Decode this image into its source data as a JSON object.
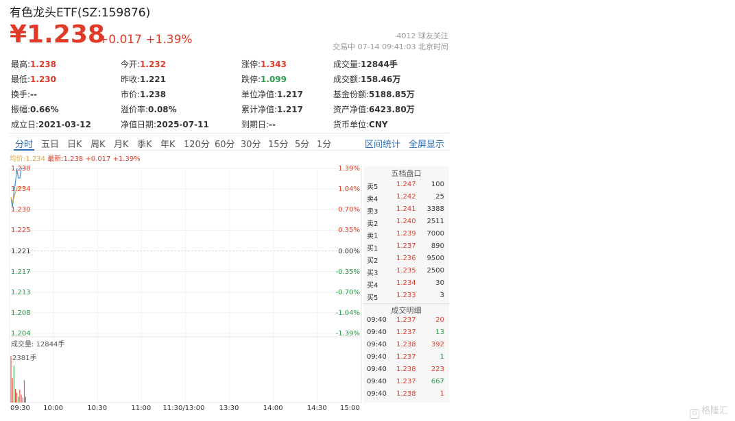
{
  "header": {
    "title": "有色龙头ETF(SZ:159876)",
    "price": "¥1.238",
    "change": "+0.017 +1.39%",
    "followers": "4012 球友关注",
    "status": "交易中 07-14 09:41:03 北京时间"
  },
  "stats": [
    [
      {
        "label": "最高:",
        "value": "1.238",
        "color": "red"
      },
      {
        "label": "今开:",
        "value": "1.232",
        "color": "red"
      },
      {
        "label": "涨停:",
        "value": "1.343",
        "color": "red"
      },
      {
        "label": "成交量:",
        "value": "12844手",
        "color": "dark"
      }
    ],
    [
      {
        "label": "最低:",
        "value": "1.230",
        "color": "red"
      },
      {
        "label": "昨收:",
        "value": "1.221",
        "color": "dark"
      },
      {
        "label": "跌停:",
        "value": "1.099",
        "color": "green"
      },
      {
        "label": "成交额:",
        "value": "158.46万",
        "color": "dark"
      }
    ],
    [
      {
        "label": "换手:",
        "value": "--",
        "color": "dark"
      },
      {
        "label": "市价:",
        "value": "1.238",
        "color": "dark"
      },
      {
        "label": "单位净值:",
        "value": "1.217",
        "color": "dark"
      },
      {
        "label": "基金份额:",
        "value": "5188.85万",
        "color": "dark"
      }
    ],
    [
      {
        "label": "振幅:",
        "value": "0.66%",
        "color": "dark"
      },
      {
        "label": "溢价率:",
        "value": "0.08%",
        "color": "dark"
      },
      {
        "label": "累计净值:",
        "value": "1.217",
        "color": "dark"
      },
      {
        "label": "资产净值:",
        "value": "6423.80万",
        "color": "dark"
      }
    ],
    [
      {
        "label": "成立日:",
        "value": "2021-03-12",
        "color": "dark"
      },
      {
        "label": "净值日期:",
        "value": "2025-07-11",
        "color": "dark"
      },
      {
        "label": "到期日:",
        "value": "--",
        "color": "dark"
      },
      {
        "label": "货币单位:",
        "value": "CNY",
        "color": "dark"
      }
    ]
  ],
  "tabs": [
    "分时",
    "五日",
    "日K",
    "周K",
    "月K",
    "季K",
    "年K",
    "120分",
    "60分",
    "30分",
    "15分",
    "5分",
    "1分"
  ],
  "active_tab": "分时",
  "tab_links": {
    "range_stats": "区间统计",
    "fullscreen": "全屏显示"
  },
  "legend": {
    "avg": "均价:1.234",
    "last": "最新:1.238 +0.017 +1.39%"
  },
  "chart_data": {
    "type": "line",
    "prev_close": 1.221,
    "y_price_ticks": [
      "1.238",
      "1.234",
      "1.230",
      "1.225",
      "1.221",
      "1.217",
      "1.213",
      "1.208",
      "1.204"
    ],
    "y_pct_ticks": [
      "1.39%",
      "1.04%",
      "0.70%",
      "0.35%",
      "0.00%",
      "-0.35%",
      "-0.70%",
      "-1.04%",
      "-1.39%"
    ],
    "ylim": [
      1.204,
      1.238
    ],
    "x_ticks": [
      "09:30",
      "10:00",
      "10:30",
      "11:00",
      "11:30/13:00",
      "13:30",
      "14:00",
      "14:30",
      "15:00"
    ],
    "series": [
      {
        "name": "最新",
        "color": "#3d8fd8",
        "values": [
          1.232,
          1.23,
          1.233,
          1.235,
          1.238,
          1.236,
          1.236,
          1.238,
          1.238,
          1.238,
          1.238
        ]
      },
      {
        "name": "均价",
        "color": "#e8a33a",
        "values": [
          1.232,
          1.231,
          1.232,
          1.233,
          1.234,
          1.234,
          1.234,
          1.234,
          1.234,
          1.234,
          1.234
        ]
      }
    ],
    "volume_label": "成交量: 12844手",
    "volume_max": "2381手",
    "volume_bars": [
      {
        "v": 2381,
        "c": "red"
      },
      {
        "v": 1250,
        "c": "red"
      },
      {
        "v": 1900,
        "c": "green"
      },
      {
        "v": 700,
        "c": "red"
      },
      {
        "v": 500,
        "c": "red"
      },
      {
        "v": 300,
        "c": "green"
      },
      {
        "v": 650,
        "c": "red"
      },
      {
        "v": 400,
        "c": "red"
      },
      {
        "v": 250,
        "c": "red"
      },
      {
        "v": 1150,
        "c": "red"
      },
      {
        "v": 300,
        "c": "red"
      }
    ]
  },
  "order_book": {
    "title": "五档盘口",
    "asks": [
      {
        "label": "卖5",
        "price": "1.247",
        "vol": "100"
      },
      {
        "label": "卖4",
        "price": "1.242",
        "vol": "25"
      },
      {
        "label": "卖3",
        "price": "1.241",
        "vol": "3388"
      },
      {
        "label": "卖2",
        "price": "1.240",
        "vol": "2511"
      },
      {
        "label": "卖1",
        "price": "1.239",
        "vol": "7000"
      }
    ],
    "bids": [
      {
        "label": "买1",
        "price": "1.237",
        "vol": "890"
      },
      {
        "label": "买2",
        "price": "1.236",
        "vol": "9500"
      },
      {
        "label": "买3",
        "price": "1.235",
        "vol": "2500"
      },
      {
        "label": "买4",
        "price": "1.234",
        "vol": "30"
      },
      {
        "label": "买5",
        "price": "1.233",
        "vol": "3"
      }
    ]
  },
  "trades": {
    "title": "成交明细",
    "rows": [
      {
        "time": "09:40",
        "price": "1.237",
        "vol": "20",
        "side": "red"
      },
      {
        "time": "09:40",
        "price": "1.237",
        "vol": "13",
        "side": "green"
      },
      {
        "time": "09:40",
        "price": "1.238",
        "vol": "392",
        "side": "red"
      },
      {
        "time": "09:40",
        "price": "1.237",
        "vol": "1",
        "side": "green"
      },
      {
        "time": "09:40",
        "price": "1.238",
        "vol": "223",
        "side": "red"
      },
      {
        "time": "09:40",
        "price": "1.237",
        "vol": "667",
        "side": "green"
      },
      {
        "time": "09:40",
        "price": "1.238",
        "vol": "1",
        "side": "red"
      }
    ]
  },
  "watermark": {
    "icon": "G",
    "text": "格隆汇"
  }
}
